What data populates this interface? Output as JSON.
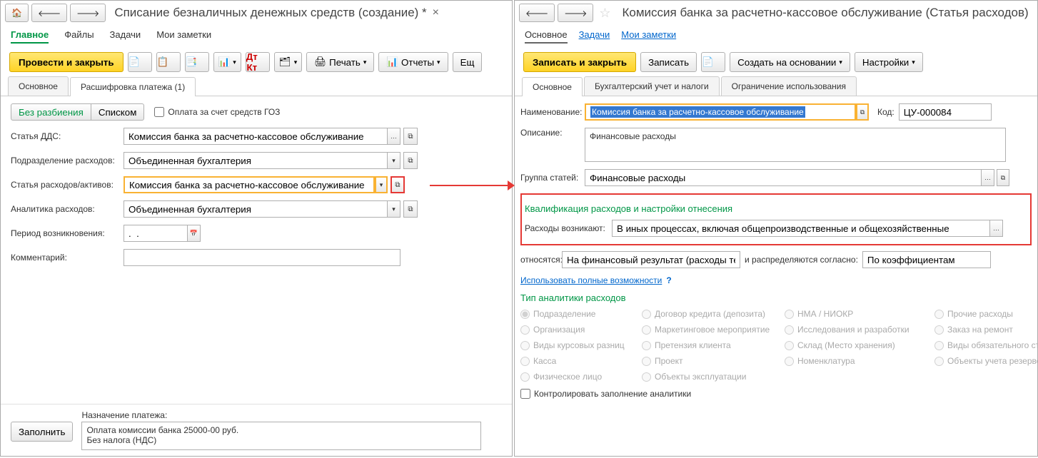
{
  "left": {
    "title": "Списание безналичных денежных средств (создание) *",
    "close_mark": "×",
    "menu": {
      "main": "Главное",
      "files": "Файлы",
      "tasks": "Задачи",
      "notes": "Мои заметки"
    },
    "toolbar": {
      "post_close": "Провести и закрыть",
      "print": "Печать",
      "reports": "Отчеты",
      "more": "Ещ"
    },
    "tabs": {
      "main": "Основное",
      "breakdown": "Расшифровка платежа (1)"
    },
    "segments": {
      "no_split": "Без разбиения",
      "list": "Списком"
    },
    "goz_checkbox": "Оплата за счет средств ГОЗ",
    "fields": {
      "dds_label": "Статья ДДС:",
      "dds_value": "Комиссия банка за расчетно-кассовое обслуживание",
      "dept_label": "Подразделение расходов:",
      "dept_value": "Объединенная бухгалтерия",
      "exp_label": "Статья расходов/активов:",
      "exp_value": "Комиссия банка за расчетно-кассовое обслуживание",
      "anal_label": "Аналитика расходов:",
      "anal_value": "Объединенная бухгалтерия",
      "period_label": "Период возникновения:",
      "period_value": ".  .",
      "comment_label": "Комментарий:"
    },
    "footer": {
      "fill": "Заполнить",
      "purpose_label": "Назначение платежа:",
      "purpose_line1": "Оплата комиссии банка 25000-00 руб.",
      "purpose_line2": "Без налога (НДС)"
    }
  },
  "right": {
    "title": "Комиссия банка за расчетно-кассовое обслуживание (Статья расходов)",
    "menu": {
      "main": "Основное",
      "tasks": "Задачи",
      "notes": "Мои заметки"
    },
    "toolbar": {
      "save_close": "Записать и закрыть",
      "save": "Записать",
      "create_on": "Создать на основании",
      "settings": "Настройки"
    },
    "tabs": {
      "main": "Основное",
      "acct": "Бухгалтерский учет и налоги",
      "limit": "Ограничение использования"
    },
    "fields": {
      "name_label": "Наименование:",
      "name_value": "Комиссия банка за расчетно-кассовое обслуживание",
      "code_label": "Код:",
      "code_value": "ЦУ-000084",
      "desc_label": "Описание:",
      "desc_value": "Финансовые расходы",
      "group_label": "Группа статей:",
      "group_value": "Финансовые расходы"
    },
    "qual": {
      "heading": "Квалификация расходов и настройки отнесения",
      "arise_label": "Расходы возникают:",
      "arise_value": "В иных процессах, включая общепроизводственные и общехозяйственные",
      "relate_label": "относятся:",
      "relate_value": "На финансовый результат (расходы тек. перио,",
      "dist_label": "и распределяются согласно:",
      "dist_value": "По коэффициентам",
      "full_link": "Использовать полные возможности",
      "q_mark": "?"
    },
    "analytics": {
      "heading": "Тип аналитики расходов",
      "options": [
        "Подразделение",
        "Договор кредита (депозита)",
        "НМА / НИОКР",
        "Прочие расходы",
        "Организация",
        "Маркетинговое мероприятие",
        "Исследования и разработки",
        "Заказ на ремонт",
        "Виды курсовых разниц",
        "Претензия клиента",
        "Склад (Место хранения)",
        "Виды обязательного стр",
        "Касса",
        "Проект",
        "Номенклатура",
        "Объекты учета резервов",
        "Физическое лицо",
        "Объекты эксплуатации"
      ],
      "control_checkbox": "Контролировать заполнение аналитики"
    }
  }
}
